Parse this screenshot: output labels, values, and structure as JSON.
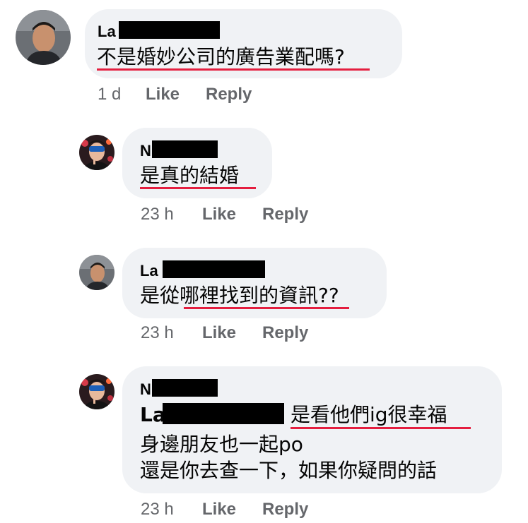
{
  "comments": [
    {
      "name_visible": "La",
      "text": "不是婚妙公司的廣告業配嗎?",
      "time": "1 d",
      "like": "Like",
      "reply": "Reply"
    },
    {
      "name_visible": "N",
      "text": "是真的結婚",
      "time": "23 h",
      "like": "Like",
      "reply": "Reply"
    },
    {
      "name_visible": "La",
      "text": "是從哪裡找到的資訊??",
      "time": "23 h",
      "like": "Like",
      "reply": "Reply"
    },
    {
      "name_visible": "N",
      "mention_visible": "La",
      "line1_rest": "是看他們ig很幸福",
      "line2": "身邊朋友也一起po",
      "line3": "還是你去查一下，如果你疑問的話",
      "time": "23 h",
      "like": "Like",
      "reply": "Reply"
    }
  ],
  "colors": {
    "bubble": "#f0f2f5",
    "text": "#050505",
    "meta": "#65676b",
    "underline": "#e41e3f",
    "redaction": "#000000"
  },
  "icons": [
    "avatar-man-icon",
    "avatar-sunglasses-icon"
  ]
}
